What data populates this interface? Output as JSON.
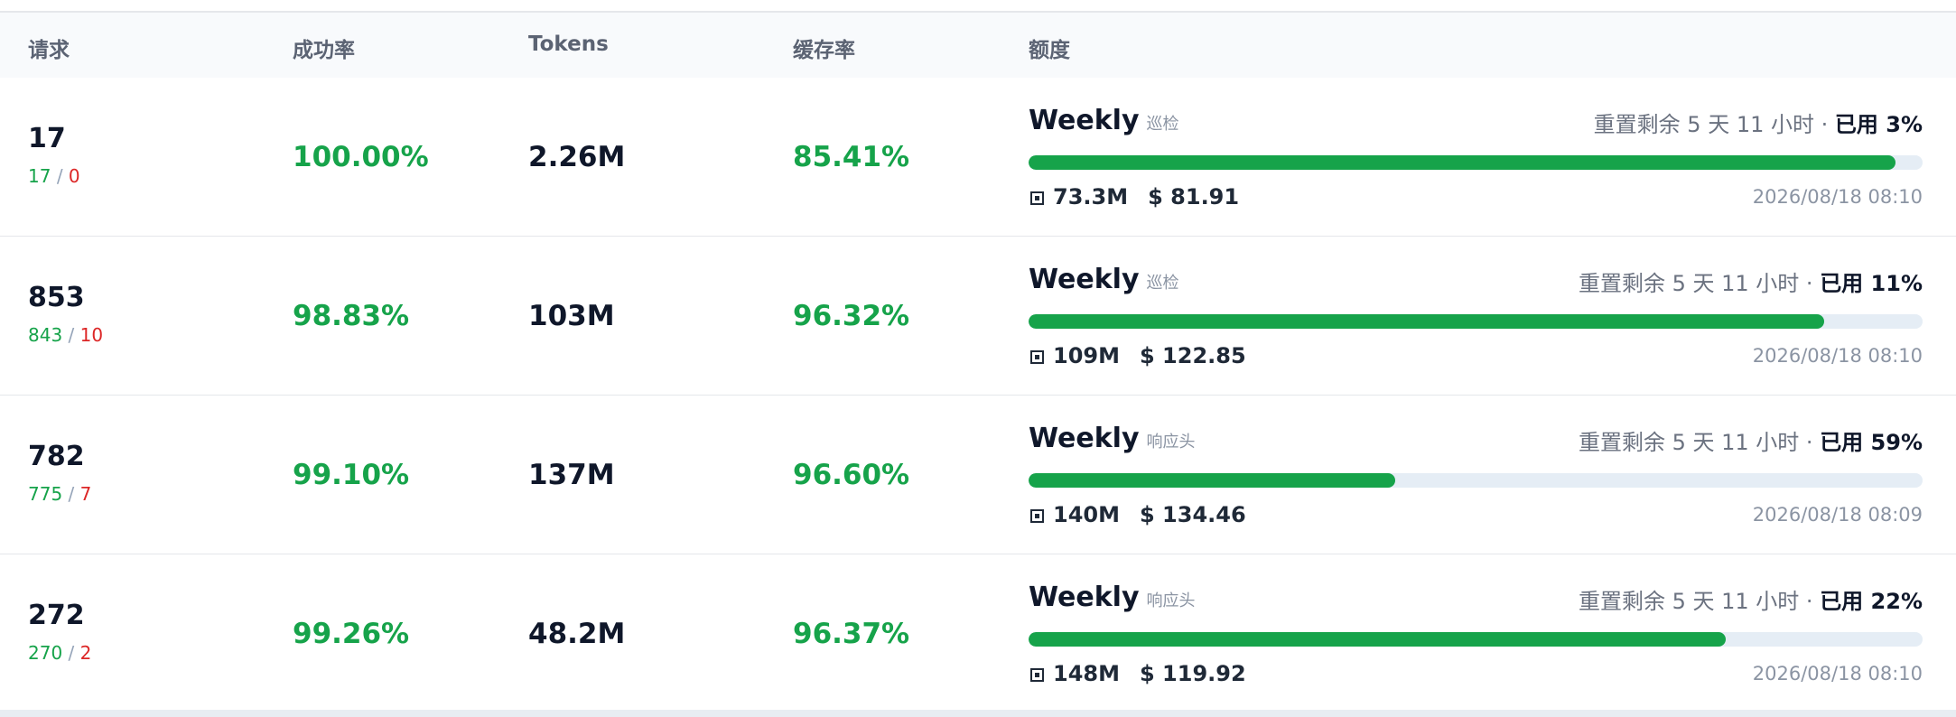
{
  "header": {
    "requests": "请求",
    "success_rate": "成功率",
    "tokens": "Tokens",
    "cache_rate": "缓存率",
    "quota": "额度"
  },
  "rows": [
    {
      "requests_total": "17",
      "requests_ok": "17",
      "requests_separator": "/",
      "requests_err": "0",
      "success_rate": "100.00%",
      "tokens": "2.26M",
      "cache_rate": "85.41%",
      "quota": {
        "name": "Weekly",
        "tag": "巡检",
        "reset_text": "重置剩余 5 天 11 小时 · ",
        "used_text": "已用 3%",
        "remaining_fraction": 0.97,
        "token_amount": "73.3M",
        "cost": "$ 81.91",
        "timestamp": "2026/08/18 08:10"
      }
    },
    {
      "requests_total": "853",
      "requests_ok": "843",
      "requests_separator": "/",
      "requests_err": "10",
      "success_rate": "98.83%",
      "tokens": "103M",
      "cache_rate": "96.32%",
      "quota": {
        "name": "Weekly",
        "tag": "巡检",
        "reset_text": "重置剩余 5 天 11 小时 · ",
        "used_text": "已用 11%",
        "remaining_fraction": 0.89,
        "token_amount": "109M",
        "cost": "$ 122.85",
        "timestamp": "2026/08/18 08:10"
      }
    },
    {
      "requests_total": "782",
      "requests_ok": "775",
      "requests_separator": "/",
      "requests_err": "7",
      "success_rate": "99.10%",
      "tokens": "137M",
      "cache_rate": "96.60%",
      "quota": {
        "name": "Weekly",
        "tag": "响应头",
        "reset_text": "重置剩余 5 天 11 小时 · ",
        "used_text": "已用 59%",
        "remaining_fraction": 0.41,
        "token_amount": "140M",
        "cost": "$ 134.46",
        "timestamp": "2026/08/18 08:09"
      }
    },
    {
      "requests_total": "272",
      "requests_ok": "270",
      "requests_separator": "/",
      "requests_err": "2",
      "success_rate": "99.26%",
      "tokens": "48.2M",
      "cache_rate": "96.37%",
      "quota": {
        "name": "Weekly",
        "tag": "响应头",
        "reset_text": "重置剩余 5 天 11 小时 · ",
        "used_text": "已用 22%",
        "remaining_fraction": 0.78,
        "token_amount": "148M",
        "cost": "$ 119.92",
        "timestamp": "2026/08/18 08:10"
      }
    }
  ],
  "icons": {
    "token_icon": "chip-icon"
  },
  "colors": {
    "success": "#16a34a",
    "error": "#dc2626",
    "bar_track": "#e5edf5",
    "header_bg": "#f8fafc"
  }
}
